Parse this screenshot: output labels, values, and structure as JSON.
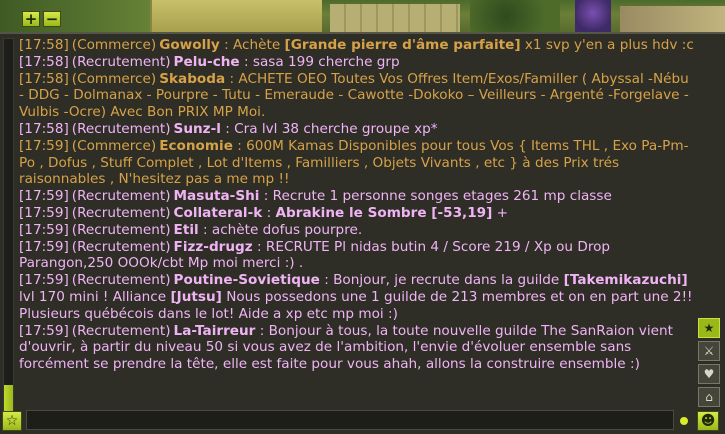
{
  "zoom": {
    "plus_label": "+",
    "minus_label": "−"
  },
  "colors": {
    "commerce": "#d6a248",
    "recrutement": "#f0b4f4",
    "accent": "#9ab81a"
  },
  "chat": {
    "messages": [
      {
        "time": "[17:58]",
        "channel": "(Commerce)",
        "sender": "Gowolly",
        "text": " : Achète ",
        "bold": "[Grande pierre d'âme parfaite]",
        "text2": " x1 svp y'en a plus hdv :c"
      },
      {
        "time": "[17:58]",
        "channel": "(Recrutement)",
        "sender": "Pelu-che",
        "text": " : sasa 199 cherche grp"
      },
      {
        "time": "[17:58]",
        "channel": "(Commerce)",
        "sender": "Skaboda",
        "text": " : ACHETE OEO Toutes Vos Offres Item/Exos/Familler ( Abyssal -Nébu - DDG - Dolmanax - Pourpre - Tutu - Emeraude - Cawotte -Dokoko – Veilleurs - Argenté -Forgelave - Vulbis -Ocre) Avec Bon PRIX MP Moi."
      },
      {
        "time": "[17:58]",
        "channel": "(Recrutement)",
        "sender": "Sunz-l",
        "text": " : Cra lvl 38 cherche groupe xp*"
      },
      {
        "time": "[17:59]",
        "channel": "(Commerce)",
        "sender": "Economie",
        "text": " : 600M Kamas Disponibles pour tous Vos { Items THL , Exo Pa-Pm-Po , Dofus , Stuff Complet , Lot d'Items , Familliers , Objets Vivants , etc } à des Prix trés raisonnables , N'hesitez pas a me mp !!"
      },
      {
        "time": "[17:59]",
        "channel": "(Recrutement)",
        "sender": "Masuta-Shi",
        "text": " : Recrute 1 personne songes etages 261 mp classe"
      },
      {
        "time": "[17:59]",
        "channel": "(Recrutement)",
        "sender": "Collateral-k",
        "text": " : ",
        "bold": "Abrakine le Sombre [-53,19]",
        "text2": " +"
      },
      {
        "time": "[17:59]",
        "channel": "(Recrutement)",
        "sender": "Etil",
        "text": " : achète dofus pourpre."
      },
      {
        "time": "[17:59]",
        "channel": "(Recrutement)",
        "sender": "Fizz-drugz",
        "text": " : RECRUTE Pl nidas butin 4 / Score 219 / Xp ou Drop Parangon,250 OOOk/cbt Mp moi merci :) ."
      },
      {
        "time": "[17:59]",
        "channel": "(Recrutement)",
        "sender": "Poutine-Sovietique",
        "text": " : Bonjour, je recrute dans la guilde ",
        "bold": "[Takemikazuchi]",
        "text2": " lvl 170 mini ! Alliance ",
        "bold2": "[Jutsu]",
        "text3": " Nous possedons une 1 guilde de 213 membres et on en part une 2!! Plusieurs québécois dans le lot! Aide a xp etc mp moi :)"
      },
      {
        "time": "[17:59]",
        "channel": "(Recrutement)",
        "sender": "La-Tairreur",
        "text": " : Bonjour à tous, la toute nouvelle guilde The SanRaion vient d'ouvrir, à partir du niveau 50 si vous avez de l'ambition, l'envie d'évoluer ensemble sans forcément se prendre la tête, elle est faite pour vous ahah, allons la construire ensemble :)"
      }
    ]
  },
  "side_icons": [
    {
      "glyph": "★",
      "name": "favorites-star-icon"
    },
    {
      "glyph": "⚔",
      "name": "swords-icon"
    },
    {
      "glyph": "♥",
      "name": "heart-icon"
    },
    {
      "glyph": "⌂",
      "name": "house-icon"
    }
  ],
  "input": {
    "star_glyph": "☆",
    "smiley_glyph": "☻",
    "value": "",
    "placeholder": ""
  }
}
